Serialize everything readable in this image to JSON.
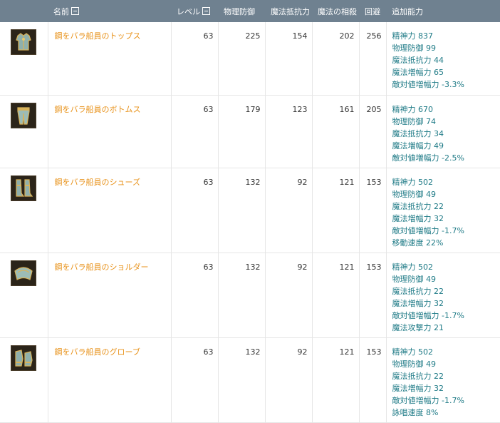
{
  "headers": {
    "name": "名前",
    "level": "レベル",
    "phys_def": "物理防御",
    "mag_res": "魔法抵抗力",
    "mag_amp": "魔法の相殺",
    "evasion": "回避",
    "extra": "追加能力"
  },
  "items": [
    {
      "icon": "armor-top-icon",
      "name": "鋼をバラ船員のトップス",
      "level": "63",
      "phys_def": "225",
      "mag_res": "154",
      "mag_amp": "202",
      "evasion": "256",
      "stats": [
        "精神力 837",
        "物理防御 99",
        "魔法抵抗力 44",
        "魔法増幅力 65",
        "敵対値増幅力 -3.3%"
      ]
    },
    {
      "icon": "armor-bottom-icon",
      "name": "鋼をバラ船員のボトムス",
      "level": "63",
      "phys_def": "179",
      "mag_res": "123",
      "mag_amp": "161",
      "evasion": "205",
      "stats": [
        "精神力 670",
        "物理防御 74",
        "魔法抵抗力 34",
        "魔法増幅力 49",
        "敵対値増幅力 -2.5%"
      ]
    },
    {
      "icon": "armor-shoes-icon",
      "name": "鋼をバラ船員のシューズ",
      "level": "63",
      "phys_def": "132",
      "mag_res": "92",
      "mag_amp": "121",
      "evasion": "153",
      "stats": [
        "精神力 502",
        "物理防御 49",
        "魔法抵抗力 22",
        "魔法増幅力 32",
        "敵対値増幅力 -1.7%",
        "移動速度 22%"
      ]
    },
    {
      "icon": "armor-shoulder-icon",
      "name": "鋼をバラ船員のショルダー",
      "level": "63",
      "phys_def": "132",
      "mag_res": "92",
      "mag_amp": "121",
      "evasion": "153",
      "stats": [
        "精神力 502",
        "物理防御 49",
        "魔法抵抗力 22",
        "魔法増幅力 32",
        "敵対値増幅力 -1.7%",
        "魔法攻撃力 21"
      ]
    },
    {
      "icon": "armor-gloves-icon",
      "name": "鋼をバラ船員のグローブ",
      "level": "63",
      "phys_def": "132",
      "mag_res": "92",
      "mag_amp": "121",
      "evasion": "153",
      "stats": [
        "精神力 502",
        "物理防御 49",
        "魔法抵抗力 22",
        "魔法増幅力 32",
        "敵対値増幅力 -1.7%",
        "詠唱速度 8%"
      ]
    }
  ]
}
